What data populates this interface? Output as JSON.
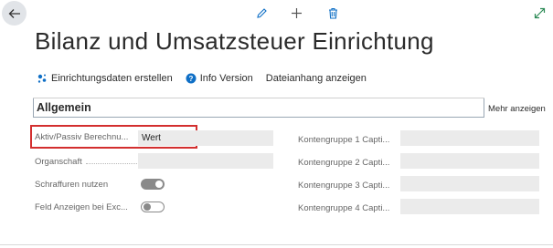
{
  "page": {
    "title": "Bilanz und Umsatzsteuer Einrichtung"
  },
  "toolbar": {
    "back_icon": "arrow-left-icon",
    "edit_icon": "pencil-icon",
    "new_icon": "plus-icon",
    "delete_icon": "trash-icon",
    "expand_icon": "expand-icon"
  },
  "actions": [
    {
      "label": "Einrichtungsdaten erstellen",
      "icon": "setup-wizard-icon"
    },
    {
      "label": "Info Version",
      "icon": "help-circle-icon"
    },
    {
      "label": "Dateianhang anzeigen",
      "icon": ""
    }
  ],
  "section": {
    "title": "Allgemein",
    "more_label": "Mehr anzeigen"
  },
  "left_fields": [
    {
      "label": "Aktiv/Passiv Berechnu...",
      "type": "text",
      "value": "Wert"
    },
    {
      "label": "Organschaft",
      "type": "text",
      "value": ""
    },
    {
      "label": "Schraffuren nutzen",
      "type": "toggle",
      "value": "on"
    },
    {
      "label": "Feld Anzeigen bei Exc...",
      "type": "toggle",
      "value": "off"
    }
  ],
  "right_fields": [
    {
      "label": "Kontengruppe 1 Capti...",
      "value": ""
    },
    {
      "label": "Kontengruppe 2 Capti...",
      "value": ""
    },
    {
      "label": "Kontengruppe 3 Capti...",
      "value": ""
    },
    {
      "label": "Kontengruppe 4 Capti...",
      "value": ""
    }
  ],
  "colors": {
    "accent": "#0f6fc6",
    "highlight": "#d32f2f",
    "field_bg": "#ebebeb",
    "expand": "#2e8b57"
  }
}
